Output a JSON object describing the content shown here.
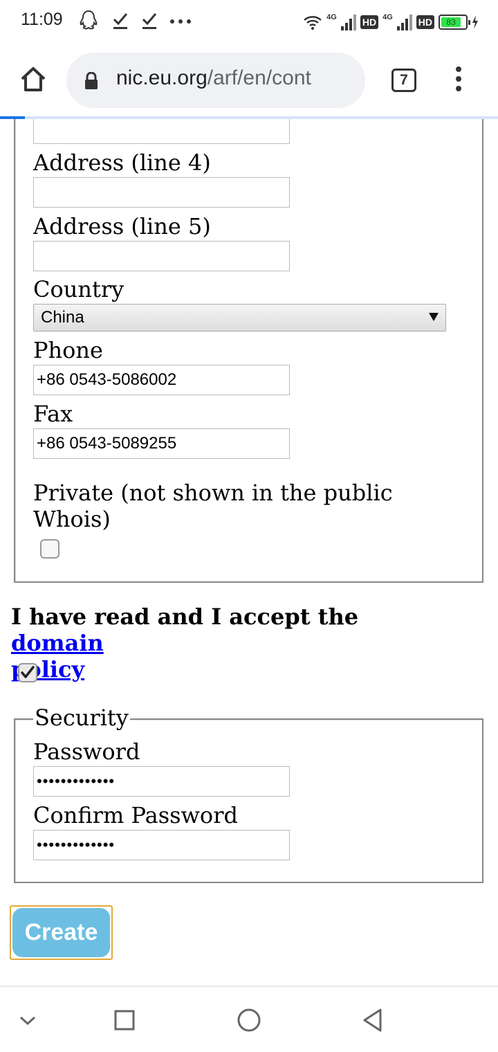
{
  "status_bar": {
    "time": "11:09",
    "icons": [
      "qq-icon",
      "download-done-icon",
      "download-done-icon",
      "more-dots-icon",
      "wifi-icon",
      "signal-icon",
      "signal-icon",
      "battery-icon"
    ],
    "network_1": "4G",
    "hd_1": "HD",
    "network_2": "4G",
    "hd_2": "HD",
    "battery_level": "83"
  },
  "browser": {
    "url_host": "nic.eu.org",
    "url_path": "/arf/en/cont",
    "tab_count": "7"
  },
  "form": {
    "address_line3_value": "",
    "address_line4_label": "Address (line 4)",
    "address_line4_value": "",
    "address_line5_label": "Address (line 5)",
    "address_line5_value": "",
    "country_label": "Country",
    "country_selected": "China",
    "phone_label": "Phone",
    "phone_value": "+86 0543-5086002",
    "fax_label": "Fax",
    "fax_value": "+86 0543-5089255",
    "private_label_line1": "Private (not shown in the public",
    "private_label_line2": "Whois)",
    "private_checked": false,
    "policy_prefix": "I have read and I accept the ",
    "policy_link_line1": "domain",
    "policy_link_line2": "policy",
    "policy_checked": true,
    "security_legend": "Security",
    "password_label": "Password",
    "password_value": "•••••••••••••",
    "confirm_password_label": "Confirm Password",
    "confirm_password_value": "•••••••••••••",
    "create_label": "Create"
  },
  "colors": {
    "create_button": "#6cbfe2",
    "link": "#0000ee",
    "progress": "#1a73e8",
    "battery": "#2ee34a"
  }
}
